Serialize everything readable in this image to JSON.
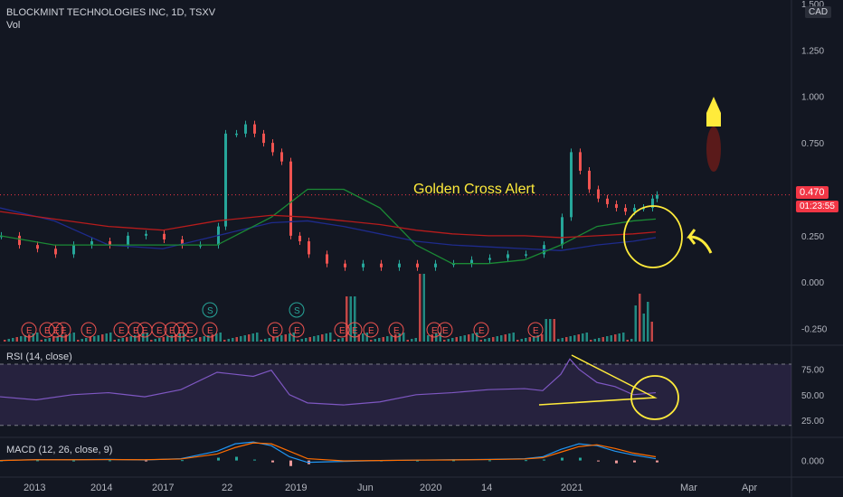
{
  "header": {
    "symbol_line": "BLOCKMINT TECHNOLOGIES INC, 1D, TSXV",
    "vol_label": "Vol",
    "currency": "CAD"
  },
  "price_tag": {
    "last": "0.470",
    "countdown": "01:23:55"
  },
  "annotation": {
    "text": "Golden Cross Alert"
  },
  "colors": {
    "bg": "#131722",
    "up": "#26a69a",
    "down": "#ef5350",
    "ma_fast": "#1b8a35",
    "ma_slow": "#b71c1c",
    "ma_blue": "#1e2b8c",
    "rsi": "#7e57c2",
    "annotation": "#ffeb3b",
    "macd_line": "#2196f3",
    "signal_line": "#ff6d00"
  },
  "chart_data": [
    {
      "type": "candlestick",
      "title": "BLOCKMINT TECHNOLOGIES INC, 1D, TSXV",
      "ylim": [
        -0.32,
        1.5
      ],
      "y_ticks": [
        "1.500",
        "1.250",
        "1.000",
        "0.750",
        "0.500",
        "0.250",
        "0.000",
        "-0.250"
      ],
      "x_ticks": [
        "2013",
        "2014",
        "2017",
        "22",
        "2019",
        "Jun",
        "2020",
        "14",
        "2021",
        "Mar",
        "Apr"
      ],
      "series": [
        {
          "kind": "price",
          "x": [
            0,
            20,
            40,
            60,
            80,
            100,
            120,
            140,
            160,
            180,
            200,
            220,
            240,
            248,
            260,
            270,
            280,
            290,
            300,
            310,
            320,
            330,
            340,
            360,
            380,
            400,
            420,
            440,
            460,
            480,
            500,
            520,
            540,
            560,
            580,
            600,
            620,
            630,
            640,
            650,
            660,
            670,
            680,
            690,
            700,
            710,
            720,
            725
          ],
          "values": [
            0.25,
            0.2,
            0.18,
            0.15,
            0.2,
            0.22,
            0.2,
            0.25,
            0.26,
            0.23,
            0.2,
            0.2,
            0.3,
            0.8,
            0.8,
            0.85,
            0.8,
            0.75,
            0.7,
            0.65,
            0.25,
            0.22,
            0.15,
            0.1,
            0.08,
            0.1,
            0.08,
            0.1,
            0.08,
            0.1,
            0.1,
            0.12,
            0.13,
            0.15,
            0.15,
            0.2,
            0.35,
            0.7,
            0.6,
            0.5,
            0.45,
            0.42,
            0.4,
            0.38,
            0.4,
            0.4,
            0.45,
            0.47
          ]
        },
        {
          "kind": "ma_fast",
          "x": [
            0,
            60,
            120,
            180,
            240,
            300,
            340,
            380,
            420,
            460,
            500,
            540,
            580,
            620,
            660,
            700,
            725
          ],
          "values": [
            0.25,
            0.2,
            0.2,
            0.2,
            0.2,
            0.35,
            0.5,
            0.5,
            0.4,
            0.2,
            0.1,
            0.1,
            0.12,
            0.2,
            0.3,
            0.33,
            0.34
          ]
        },
        {
          "kind": "ma_slow",
          "x": [
            0,
            60,
            120,
            180,
            240,
            300,
            340,
            380,
            420,
            460,
            500,
            540,
            580,
            620,
            660,
            700,
            725
          ],
          "values": [
            0.38,
            0.34,
            0.3,
            0.28,
            0.33,
            0.36,
            0.35,
            0.33,
            0.31,
            0.28,
            0.26,
            0.25,
            0.25,
            0.24,
            0.25,
            0.26,
            0.27
          ]
        },
        {
          "kind": "ma_blue",
          "x": [
            0,
            60,
            120,
            180,
            240,
            300,
            340,
            380,
            420,
            460,
            500,
            540,
            580,
            620,
            660,
            700,
            725
          ],
          "values": [
            0.4,
            0.33,
            0.2,
            0.18,
            0.25,
            0.32,
            0.33,
            0.3,
            0.26,
            0.22,
            0.2,
            0.19,
            0.18,
            0.17,
            0.2,
            0.22,
            0.24
          ]
        }
      ],
      "events_E": [
        32,
        52,
        62,
        70,
        98,
        134,
        150,
        160,
        176,
        190,
        200,
        210,
        232,
        304,
        328,
        378,
        392,
        410,
        438,
        480,
        492,
        532,
        592
      ],
      "events_S": [
        232,
        328
      ]
    },
    {
      "type": "line",
      "title": "RSI (14, close)",
      "ylim": [
        10,
        95
      ],
      "y_ticks": [
        "75.00",
        "50.00",
        "25.00"
      ],
      "bands": [
        20,
        80
      ],
      "series": [
        {
          "x": [
            0,
            40,
            80,
            120,
            160,
            200,
            240,
            280,
            300,
            320,
            340,
            380,
            420,
            460,
            500,
            540,
            580,
            600,
            620,
            630,
            640,
            660,
            680,
            700,
            725
          ],
          "values": [
            48,
            45,
            50,
            52,
            48,
            55,
            72,
            68,
            74,
            50,
            42,
            40,
            43,
            50,
            52,
            55,
            56,
            54,
            70,
            85,
            75,
            62,
            58,
            50,
            52
          ]
        }
      ]
    },
    {
      "type": "line",
      "title": "MACD (12, 26, close, 9)",
      "ylim": [
        -0.08,
        0.12
      ],
      "y_ticks": [
        "0.000"
      ],
      "series": [
        {
          "name": "MACD",
          "x": [
            0,
            40,
            80,
            120,
            160,
            200,
            240,
            260,
            280,
            300,
            320,
            340,
            380,
            420,
            460,
            500,
            540,
            580,
            600,
            620,
            640,
            660,
            680,
            700,
            725
          ],
          "values": [
            0,
            0.005,
            0.004,
            0.006,
            0.003,
            0.01,
            0.05,
            0.09,
            0.1,
            0.08,
            0.02,
            -0.01,
            -0.005,
            0.0,
            0.002,
            0.004,
            0.006,
            0.01,
            0.02,
            0.06,
            0.09,
            0.08,
            0.05,
            0.03,
            0.01
          ]
        },
        {
          "name": "Signal",
          "x": [
            0,
            40,
            80,
            120,
            160,
            200,
            240,
            260,
            280,
            300,
            320,
            340,
            380,
            420,
            460,
            500,
            540,
            580,
            600,
            620,
            640,
            660,
            680,
            700,
            725
          ],
          "values": [
            0,
            0.004,
            0.004,
            0.005,
            0.004,
            0.008,
            0.035,
            0.07,
            0.095,
            0.09,
            0.05,
            0.01,
            -0.002,
            0.0,
            0.002,
            0.003,
            0.005,
            0.008,
            0.015,
            0.045,
            0.075,
            0.085,
            0.065,
            0.04,
            0.02
          ]
        }
      ]
    }
  ],
  "axis_texts": {
    "price": [
      "1.500",
      "1.250",
      "1.000",
      "0.750",
      "0.500",
      "0.250",
      "0.000",
      "-0.250"
    ],
    "rsi": [
      "75.00",
      "50.00",
      "25.00"
    ],
    "macd": [
      "0.000"
    ],
    "time": [
      "2013",
      "2014",
      "2017",
      "22",
      "2019",
      "Jun",
      "2020",
      "14",
      "2021",
      "Mar",
      "Apr"
    ]
  }
}
